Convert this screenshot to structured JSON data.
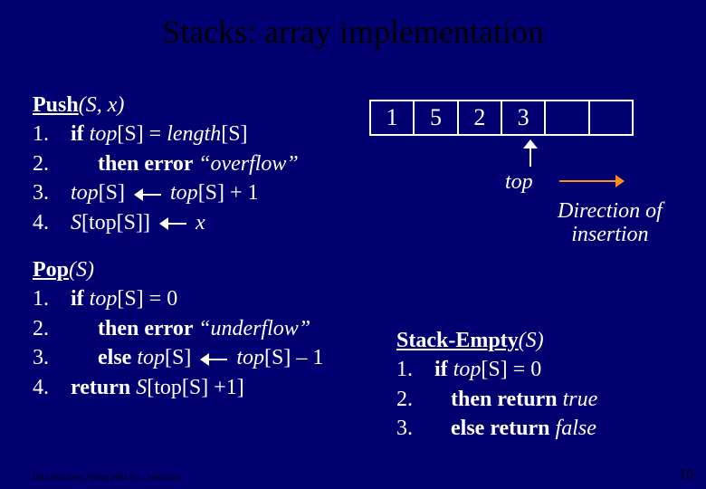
{
  "title": "Stacks: array implementation",
  "push": {
    "name": "Push",
    "args": "(S, x)",
    "lines": {
      "n1": "1.",
      "l1a": "if ",
      "l1b": "top",
      "l1c": "[S] = ",
      "l1d": "length",
      "l1e": "[S]",
      "n2": "2.",
      "l2a": "then error ",
      "l2b": "“overflow”",
      "n3": "3.",
      "l3a": "top",
      "l3b": "[S] ",
      "l3c": " top",
      "l3d": "[S] + 1",
      "n4": "4.",
      "l4a": "S",
      "l4b": "[top",
      "l4c": "[S]] ",
      "l4d": " x"
    }
  },
  "pop": {
    "name": "Pop",
    "args": "(S)",
    "lines": {
      "n1": "1.",
      "l1a": "if ",
      "l1b": "top",
      "l1c": "[S] = 0",
      "n2": "2.",
      "l2a": "then error ",
      "l2b": "“underflow”",
      "n3": "3.",
      "l3a": "else ",
      "l3b": "top",
      "l3c": "[S] ",
      "l3d": " top",
      "l3e": "[S] – 1",
      "n4": "4.",
      "l4a": "return ",
      "l4b": "S",
      "l4c": "[top",
      "l4d": "[S] +1]"
    }
  },
  "empty": {
    "name": "Stack-Empty",
    "args": "(S)",
    "lines": {
      "n1": "1.",
      "l1a": "if ",
      "l1b": "top",
      "l1c": "[S] = 0",
      "n2": "2.",
      "l2a": "then return ",
      "l2b": "true",
      "n3": "3.",
      "l3a": "else return ",
      "l3b": "false"
    }
  },
  "array": [
    "1",
    "5",
    "2",
    "3",
    "",
    ""
  ],
  "labels": {
    "top": "top",
    "direction1": "Direction of",
    "direction2": "insertion"
  },
  "footer": "Data Structures, Spring 2004 © L. Joskowicz",
  "pagenum": "10",
  "chart_data": {
    "type": "table",
    "description": "Array representation of a stack",
    "cells": [
      1,
      5,
      2,
      3,
      null,
      null
    ],
    "top_index": 3,
    "capacity": 6,
    "insertion_direction": "right"
  }
}
